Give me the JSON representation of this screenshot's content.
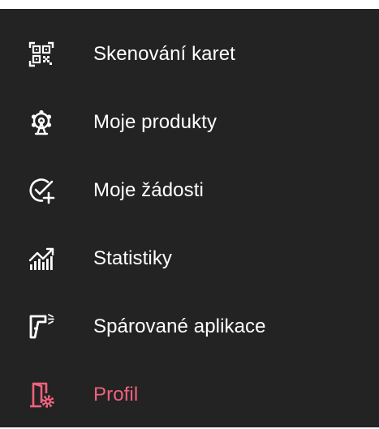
{
  "menu": {
    "items": [
      {
        "label": "Skenování karet",
        "icon": "qr-scan-icon"
      },
      {
        "label": "Moje produkty",
        "icon": "products-ferris-wheel-icon"
      },
      {
        "label": "Moje žádosti",
        "icon": "requests-check-plus-icon"
      },
      {
        "label": "Statistiky",
        "icon": "statistics-chart-icon"
      },
      {
        "label": "Spárované aplikace",
        "icon": "paired-apps-scanner-icon"
      },
      {
        "label": "Profil",
        "icon": "profile-door-gear-icon"
      }
    ],
    "active_index": 5
  },
  "colors": {
    "panel_background": "#232323",
    "text": "#ffffff",
    "accent": "#f0617e"
  }
}
